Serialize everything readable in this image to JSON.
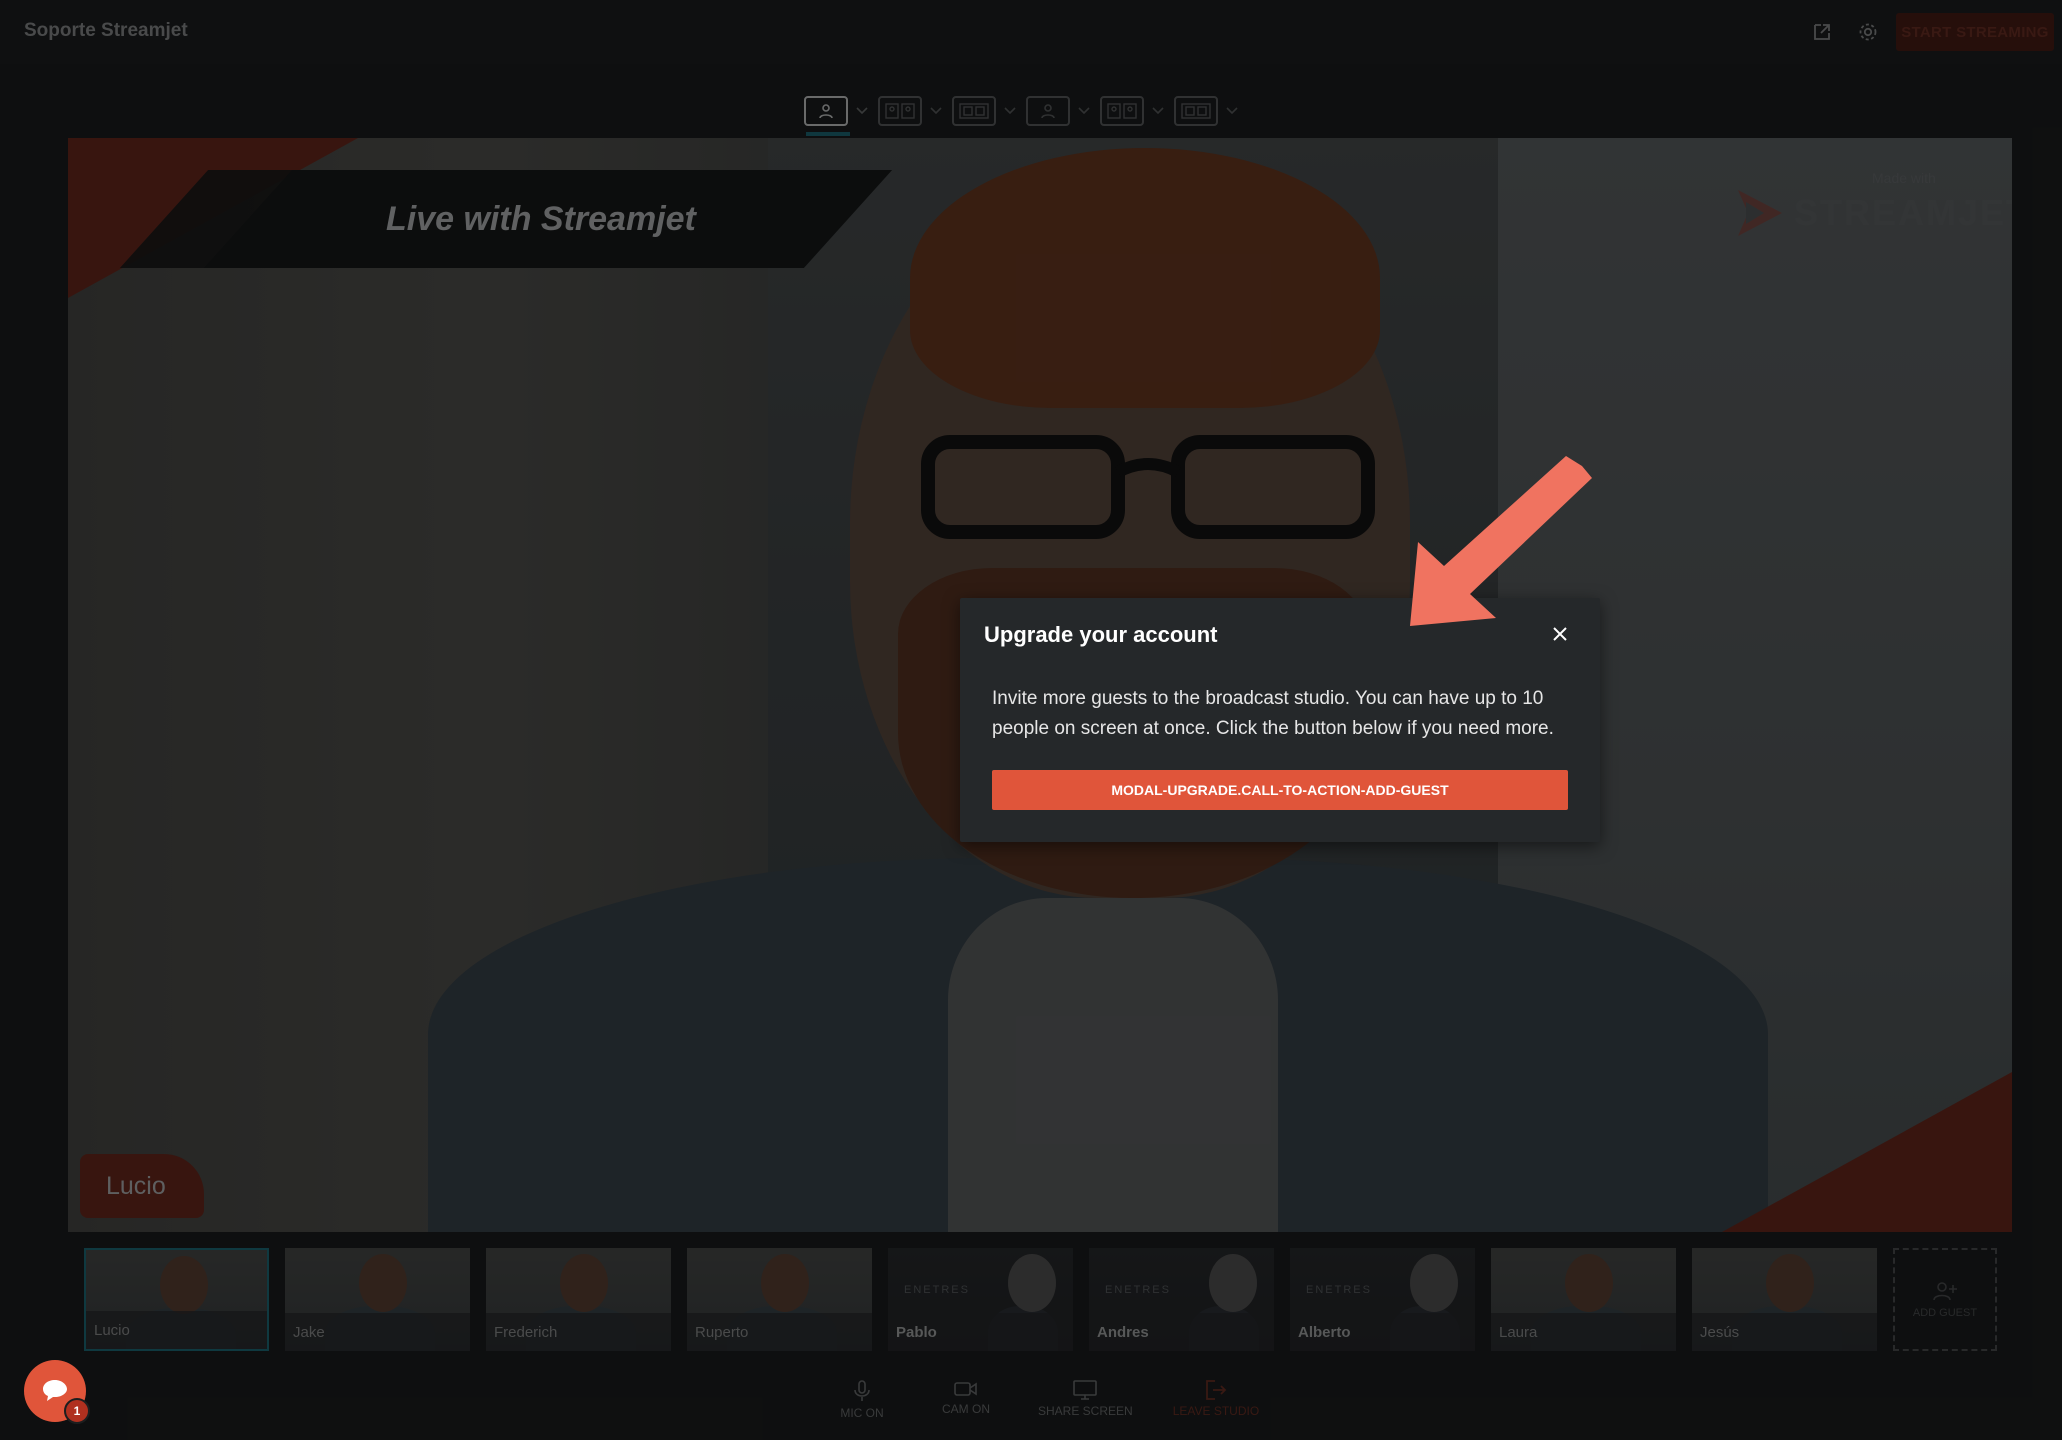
{
  "app": {
    "title": "Soporte Streamjet",
    "start_streaming_label": "START STREAMING"
  },
  "layouts": [
    {
      "name": "single",
      "active": true
    },
    {
      "name": "two-up"
    },
    {
      "name": "two-framed"
    },
    {
      "name": "single-alt"
    },
    {
      "name": "two-up-alt"
    },
    {
      "name": "two-framed-alt"
    }
  ],
  "stage": {
    "banner_text": "Live with Streamjet",
    "brand_made_with": "Made with",
    "brand_name": "STREAMJET",
    "speaker_name": "Lucio"
  },
  "guests": [
    {
      "name": "Lucio",
      "style": "video",
      "active": true
    },
    {
      "name": "Jake",
      "style": "video"
    },
    {
      "name": "Frederich",
      "style": "video"
    },
    {
      "name": "Ruperto",
      "style": "video"
    },
    {
      "name": "Pablo",
      "style": "avatar",
      "logo": "ENETRES"
    },
    {
      "name": "Andres",
      "style": "avatar",
      "logo": "ENETRES"
    },
    {
      "name": "Alberto",
      "style": "avatar",
      "logo": "ENETRES"
    },
    {
      "name": "Laura",
      "style": "video"
    },
    {
      "name": "Jesús",
      "style": "video"
    }
  ],
  "add_guest_label": "ADD GUEST",
  "controls": {
    "mic": "MIC ON",
    "cam": "CAM ON",
    "share": "SHARE SCREEN",
    "leave": "LEAVE STUDIO"
  },
  "chat": {
    "unread_count": "1"
  },
  "modal": {
    "title": "Upgrade your account",
    "body": "Invite more guests to the broadcast studio. You can have up to 10 people on screen at once. Click the button below if you need more.",
    "cta_label": "MODAL-UPGRADE.CALL-TO-ACTION-ADD-GUEST"
  },
  "colors": {
    "accent": "#e0553a",
    "highlight": "#1e6e7c",
    "annotation_arrow": "#f07360"
  }
}
